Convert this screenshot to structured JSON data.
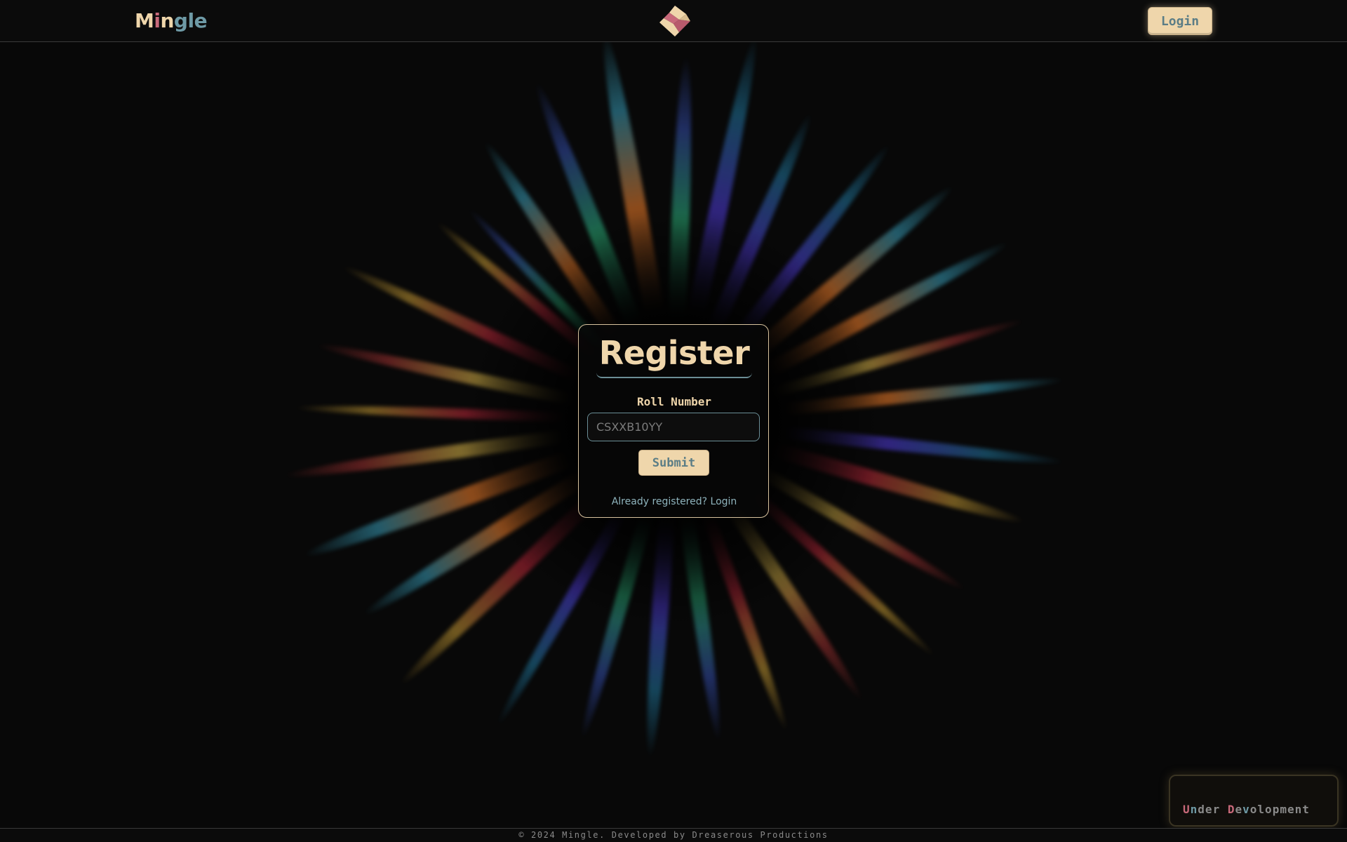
{
  "app": {
    "brand_letters": [
      "M",
      "i",
      "n",
      "g",
      "l",
      "e"
    ],
    "logo_icon": "diamond-logo-icon",
    "colors": {
      "cream": "#efd6ab",
      "rose": "#c8697a",
      "teal": "#6e9aa6",
      "background": "#080808"
    }
  },
  "header": {
    "login_label": "Login"
  },
  "register": {
    "title": "Register",
    "field_label": "Roll Number",
    "roll_placeholder": "CSXXB10YY",
    "submit_label": "Submit",
    "login_link": "Already registered? Login"
  },
  "status": {
    "letters": [
      "U",
      "n",
      "d",
      "e",
      "r",
      " ",
      "D",
      "e",
      "v",
      "o",
      "l",
      "o",
      "p",
      "m",
      "e",
      "n",
      "t"
    ]
  },
  "footer": {
    "text": "© 2024 Mingle. Developed by Dreaserous Productions"
  }
}
